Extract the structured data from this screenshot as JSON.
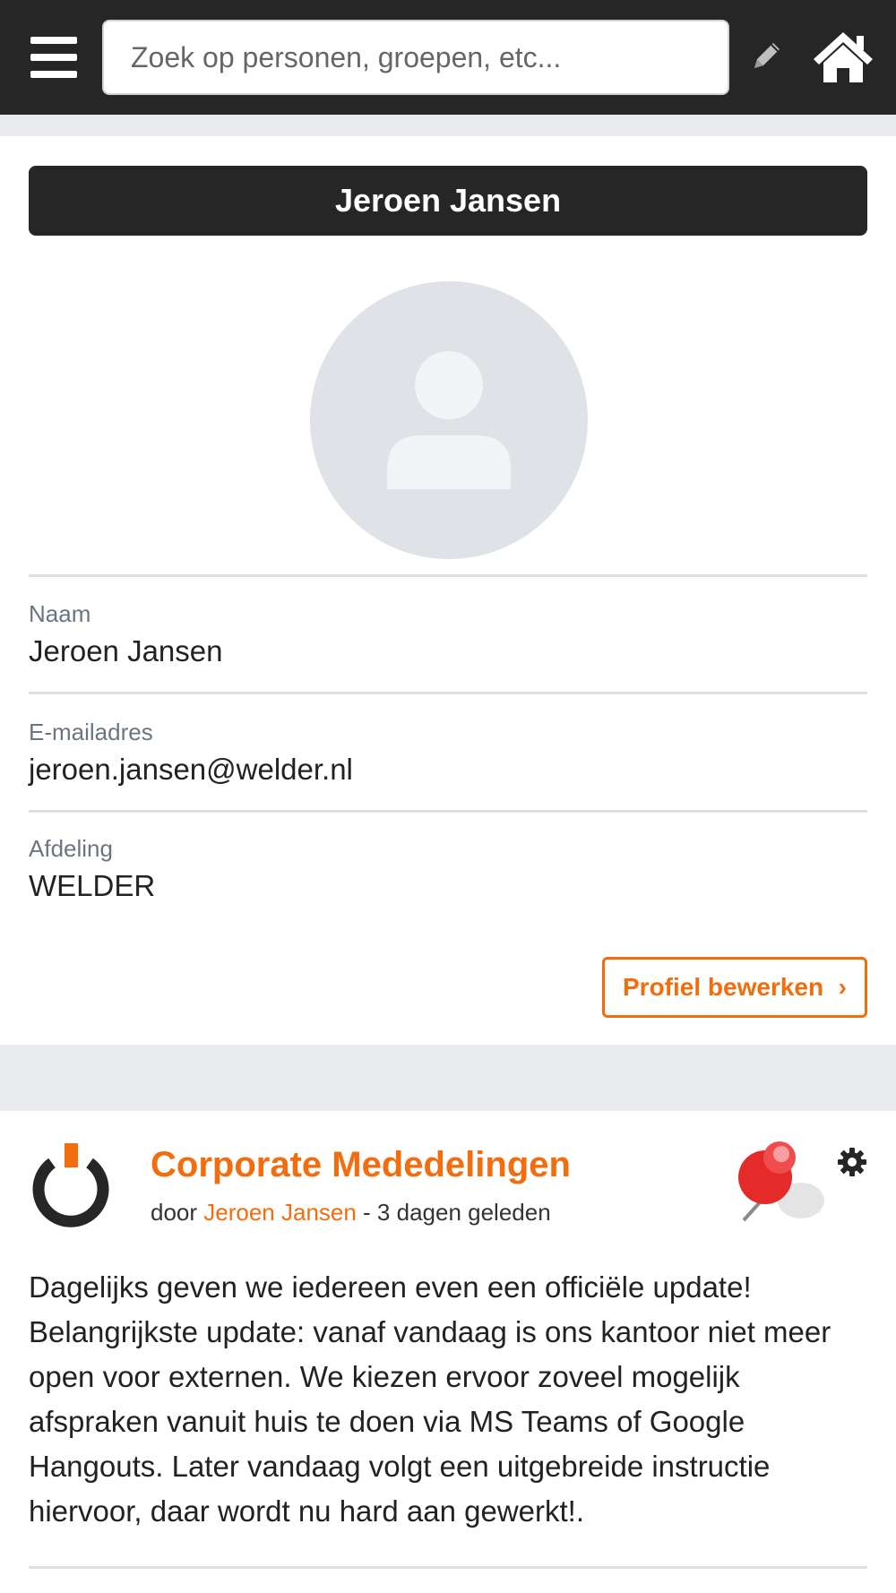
{
  "header": {
    "search_placeholder": "Zoek op personen, groepen, etc...",
    "menu_icon": "hamburger-menu-icon",
    "edit_icon": "pencil-icon",
    "home_icon": "home-icon"
  },
  "profile": {
    "title": "Jeroen Jansen",
    "fields": [
      {
        "label": "Naam",
        "value": "Jeroen Jansen"
      },
      {
        "label": "E-mailadres",
        "value": "jeroen.jansen@welder.nl"
      },
      {
        "label": "Afdeling",
        "value": "WELDER"
      }
    ],
    "edit_button": "Profiel bewerken",
    "edit_chevron": "›"
  },
  "post": {
    "title": "Corporate Mededelingen",
    "by_prefix": "door ",
    "author": "Jeroen Jansen",
    "time": " - 3 dagen geleden",
    "body": "Dagelijks geven we iedereen even een officiële update! Belangrijkste update: vanaf vandaag is ons kantoor niet meer open voor externen. We kiezen ervoor zoveel mogelijk afspraken vanuit huis te doen via MS Teams of Google Hangouts. Later vandaag volgt een uitgebreide instructie hiervoor, daar wordt nu hard aan gewerkt!."
  },
  "colors": {
    "accent": "#f36c0e",
    "topbar": "#262626",
    "background": "#e9ebee"
  }
}
